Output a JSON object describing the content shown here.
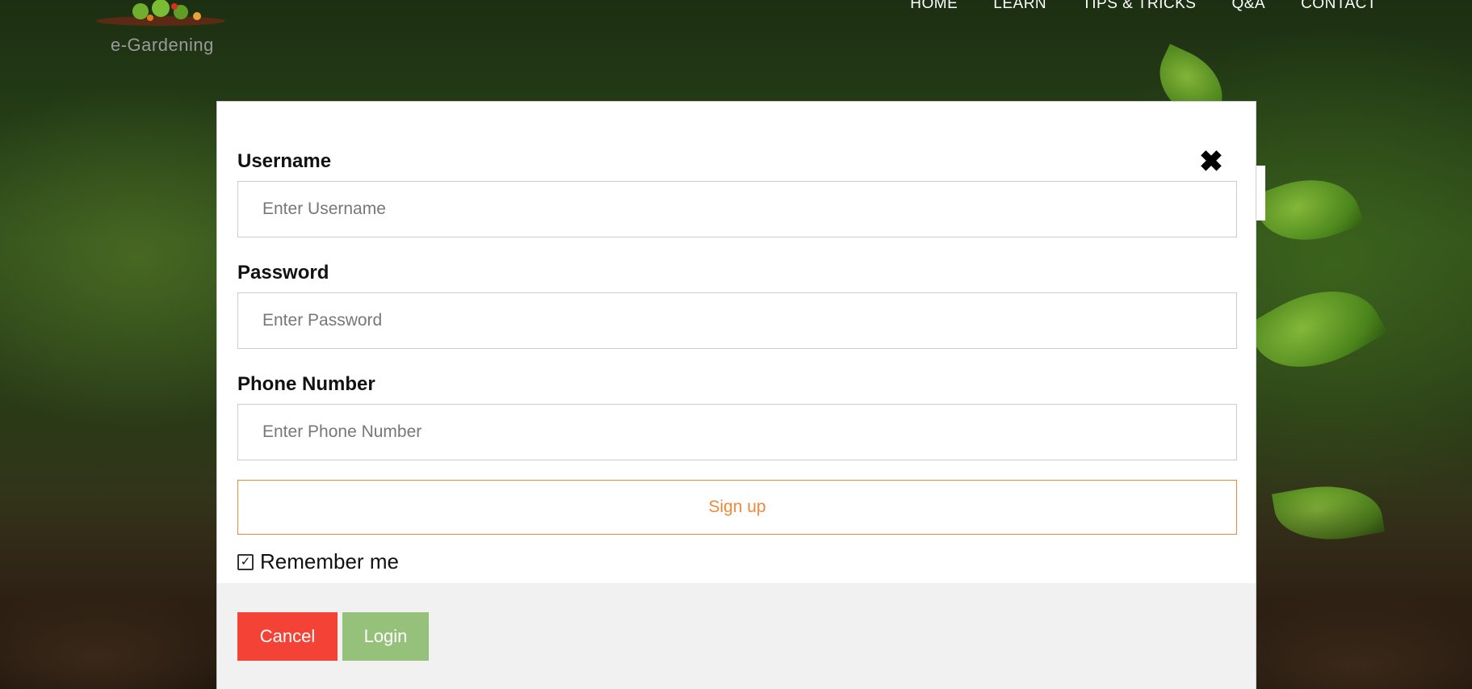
{
  "header": {
    "logo_text": "e-Gardening",
    "nav": [
      "HOME",
      "LEARN",
      "TIPS & TRICKS",
      "Q&A",
      "CONTACT"
    ]
  },
  "modal": {
    "close_symbol": "✖",
    "fields": [
      {
        "label": "Username",
        "placeholder": "Enter Username"
      },
      {
        "label": "Password",
        "placeholder": "Enter Password"
      },
      {
        "label": "Phone Number",
        "placeholder": "Enter Phone Number"
      }
    ],
    "signup_label": "Sign up",
    "remember_label": "Remember me",
    "remember_checked": true,
    "cancel_label": "Cancel",
    "login_label": "Login"
  },
  "colors": {
    "cancel": "#f44336",
    "login": "#95c17a",
    "signup_accent": "#f0883a"
  },
  "icons": {
    "close": "close-icon",
    "checkbox": "checkbox-checked-icon"
  }
}
